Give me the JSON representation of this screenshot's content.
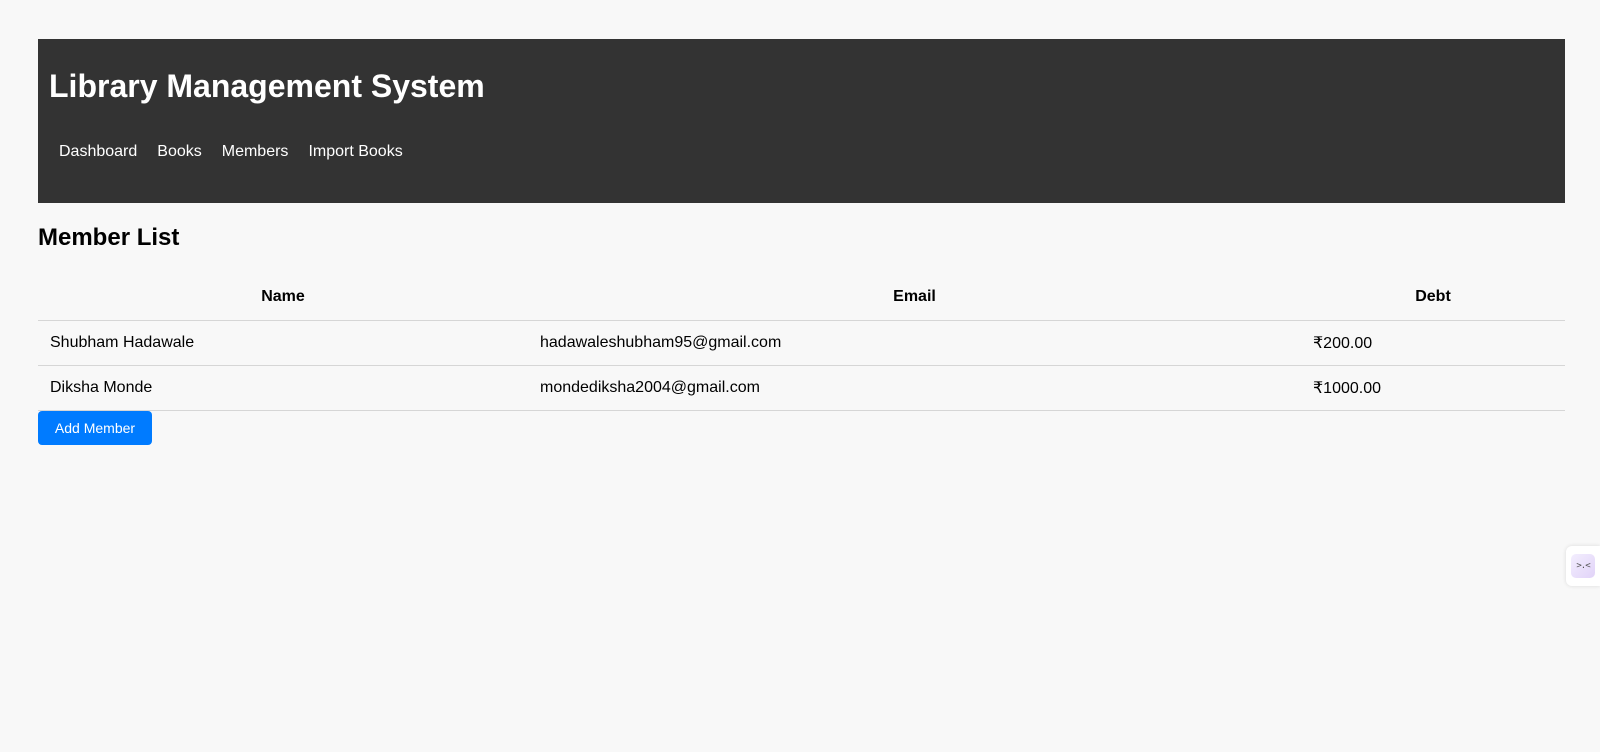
{
  "header": {
    "title": "Library Management System",
    "nav": [
      {
        "label": "Dashboard"
      },
      {
        "label": "Books"
      },
      {
        "label": "Members"
      },
      {
        "label": "Import Books"
      }
    ]
  },
  "main": {
    "title": "Member List",
    "table": {
      "columns": [
        "Name",
        "Email",
        "Debt"
      ],
      "rows": [
        {
          "name": "Shubham Hadawale",
          "email": "hadawaleshubham95@gmail.com",
          "debt": "₹200.00"
        },
        {
          "name": "Diksha Monde",
          "email": "mondediksha2004@gmail.com",
          "debt": "₹1000.00"
        }
      ]
    },
    "add_member_label": "Add Member"
  },
  "extension_widget": {
    "icon": "extension-icon",
    "glyph": ">.<"
  },
  "colors": {
    "header_bg": "#333333",
    "page_bg": "#f8f8f8",
    "button_bg": "#007bff",
    "row_border": "#d6d6d6"
  }
}
